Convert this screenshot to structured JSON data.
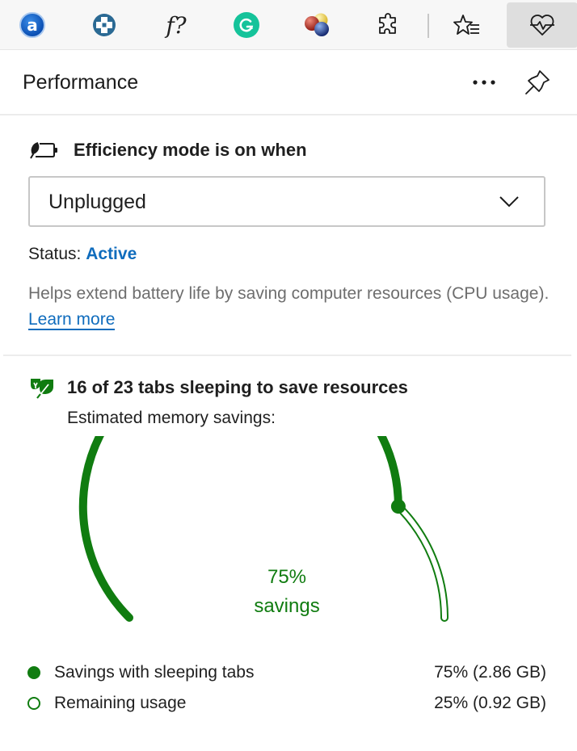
{
  "toolbar": {
    "items": [
      {
        "name": "avast-extension",
        "icon": "a"
      },
      {
        "name": "medical-cross-extension",
        "icon": "plus-cross"
      },
      {
        "name": "formula-extension",
        "icon": "f?"
      },
      {
        "name": "grammarly-extension",
        "icon": "G"
      },
      {
        "name": "color-balls-extension",
        "icon": "balls"
      },
      {
        "name": "extensions",
        "icon": "puzzle-icon"
      },
      {
        "name": "favorites",
        "icon": "star-list-icon"
      },
      {
        "name": "performance",
        "icon": "heart-pulse-icon",
        "active": true
      }
    ],
    "ext_a_glyph": "a",
    "ext_f_glyph": "f?"
  },
  "panel": {
    "title": "Performance",
    "more_label": "More options",
    "pin_label": "Pin"
  },
  "efficiency": {
    "label": "Efficiency mode is on when",
    "selected": "Unplugged",
    "status_prefix": "Status:",
    "status_value": "Active",
    "description": "Helps extend battery life by saving computer resources (CPU usage).",
    "learn_more": "Learn more"
  },
  "sleeping": {
    "label": "16 of 23 tabs sleeping to save resources",
    "estimated_label": "Estimated memory savings:"
  },
  "chart_data": {
    "type": "gauge",
    "value_percent": 75,
    "center_line1": "75%",
    "center_line2": "savings",
    "range": [
      0,
      100
    ],
    "colors": {
      "filled": "#107c10",
      "remaining": "#107c10"
    },
    "series": [
      {
        "name": "Savings with sleeping tabs",
        "percent": 75,
        "display": "75% (2.86 GB)",
        "gb": 2.86,
        "marker": "filled"
      },
      {
        "name": "Remaining usage",
        "percent": 25,
        "display": "25% (0.92 GB)",
        "gb": 0.92,
        "marker": "hollow"
      }
    ]
  }
}
